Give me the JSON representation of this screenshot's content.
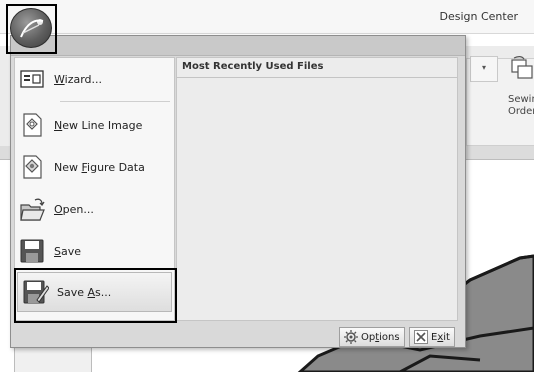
{
  "window": {
    "title": "Design Center"
  },
  "app_menu": {
    "items": [
      {
        "pre": "",
        "key": "W",
        "post": "izard...",
        "icon": "wizard-icon"
      },
      {
        "pre": "",
        "key": "N",
        "post": "ew Line Image",
        "icon": "new-line-image-icon"
      },
      {
        "pre": "New ",
        "key": "F",
        "post": "igure Data",
        "icon": "new-figure-data-icon"
      },
      {
        "pre": "",
        "key": "O",
        "post": "pen...",
        "icon": "open-folder-icon"
      },
      {
        "pre": "",
        "key": "S",
        "post": "ave",
        "icon": "save-icon"
      },
      {
        "pre": "Save ",
        "key": "A",
        "post": "s...",
        "icon": "save-as-icon"
      }
    ],
    "mru_header": "Most Recently Used Files",
    "options_button": {
      "pre": "Op",
      "key": "t",
      "post": "ions"
    },
    "exit_button": {
      "pre": "E",
      "key": "x",
      "post": "it"
    }
  },
  "ribbon": {
    "sewing_order_label": "Sewing Order",
    "dropdown_arrow": "▾"
  },
  "colors": {
    "accent": "#000000",
    "menu_bg": "#d9d9d9",
    "canvas_shape": "#8a8a8a"
  }
}
